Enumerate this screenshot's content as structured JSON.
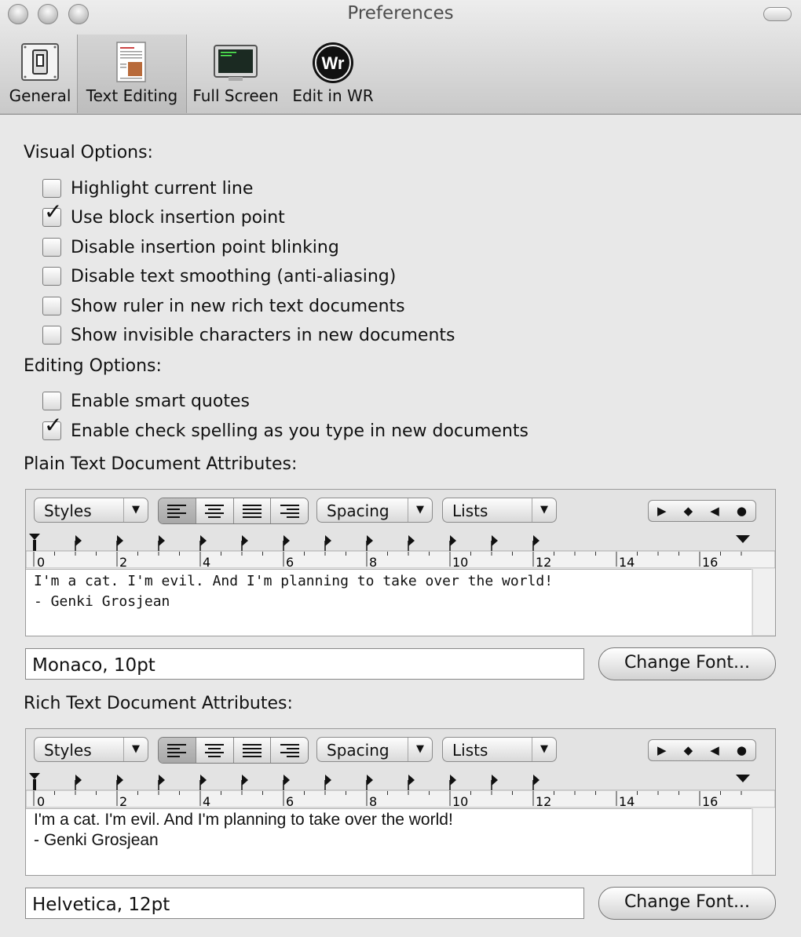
{
  "window": {
    "title": "Preferences"
  },
  "toolbar": {
    "items": [
      {
        "label": "General",
        "icon": "switch-icon"
      },
      {
        "label": "Text Editing",
        "icon": "document-icon"
      },
      {
        "label": "Full Screen",
        "icon": "monitor-icon"
      },
      {
        "label": "Edit in WR",
        "icon": "wr-icon",
        "icon_text": "Wr"
      }
    ],
    "selected": "Text Editing"
  },
  "visual_options": {
    "heading": "Visual Options:",
    "items": [
      {
        "label": "Highlight current line",
        "checked": false
      },
      {
        "label": "Use block insertion point",
        "checked": true
      },
      {
        "label": "Disable insertion point blinking",
        "checked": false
      },
      {
        "label": "Disable text smoothing (anti-aliasing)",
        "checked": false
      },
      {
        "label": "Show ruler in new rich text documents",
        "checked": false
      },
      {
        "label": "Show invisible characters in new documents",
        "checked": false
      }
    ]
  },
  "editing_options": {
    "heading": "Editing Options:",
    "items": [
      {
        "label": "Enable smart quotes",
        "checked": false
      },
      {
        "label": "Enable check spelling as you type in new documents",
        "checked": true
      }
    ]
  },
  "plain_text": {
    "heading": "Plain Text Document Attributes:",
    "styles_label": "Styles",
    "spacing_label": "Spacing",
    "lists_label": "Lists",
    "ruler_labels": [
      "0",
      "2",
      "4",
      "6",
      "8",
      "10",
      "12",
      "14",
      "16"
    ],
    "sample_line1": "I'm a cat. I'm evil. And I'm planning to take over the world!",
    "sample_line2": "- Genki Grosjean",
    "font_value": "Monaco, 10pt",
    "change_font_label": "Change Font..."
  },
  "rich_text": {
    "heading": "Rich Text Document Attributes:",
    "styles_label": "Styles",
    "spacing_label": "Spacing",
    "lists_label": "Lists",
    "ruler_labels": [
      "0",
      "2",
      "4",
      "6",
      "8",
      "10",
      "12",
      "14",
      "16"
    ],
    "sample_line1": "I'm a cat. I'm evil. And I'm planning to take over the world!",
    "sample_line2": "- Genki Grosjean",
    "font_value": "Helvetica, 12pt",
    "change_font_label": "Change Font..."
  }
}
